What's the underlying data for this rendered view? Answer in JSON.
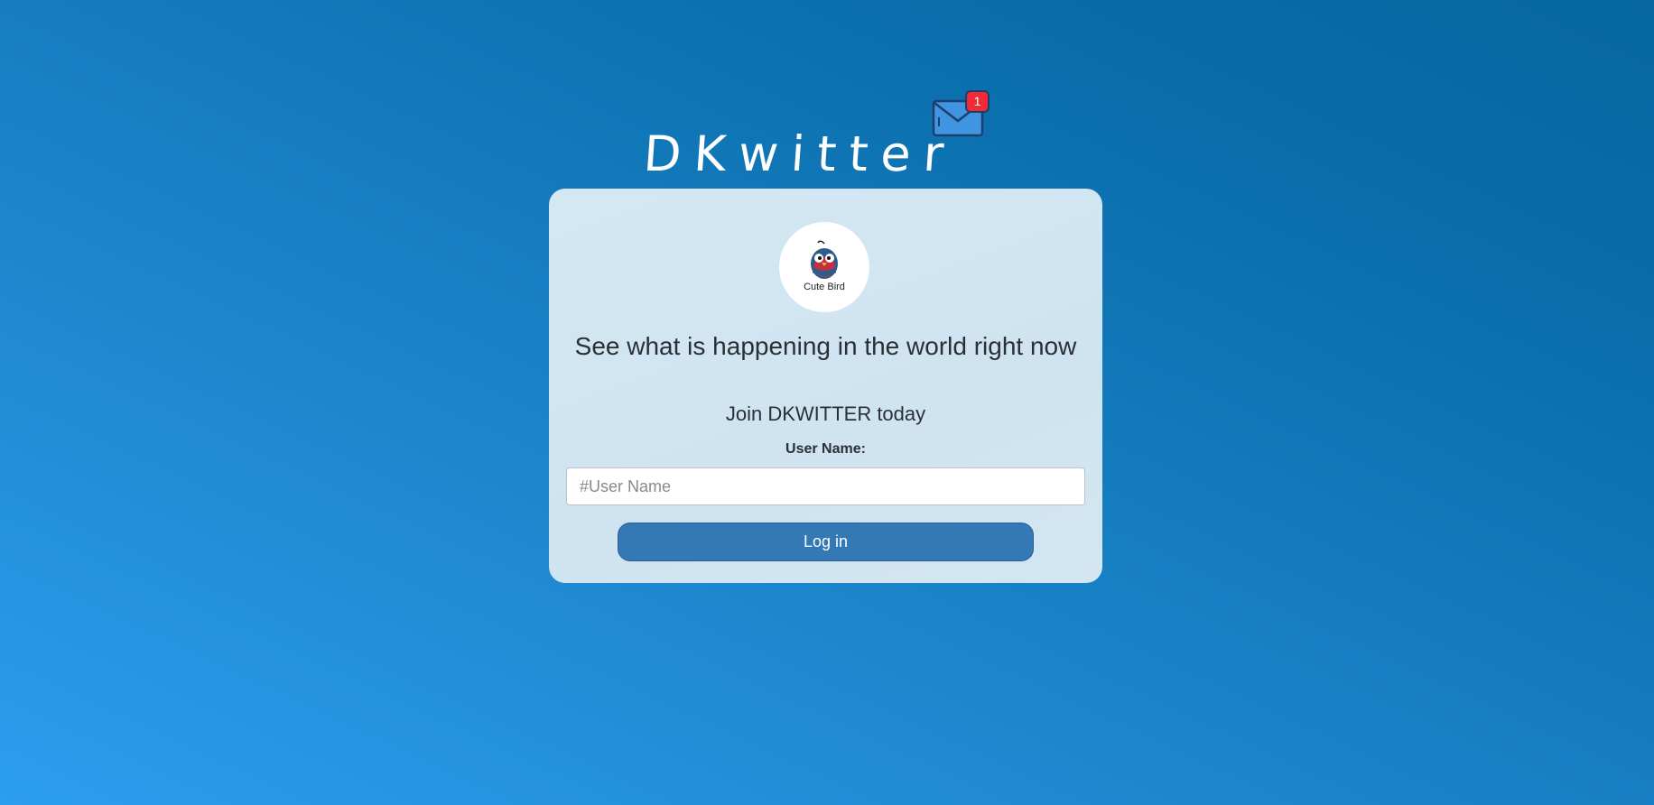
{
  "header": {
    "app_title": "DKwitter",
    "mail_icon": "envelope-notification-icon",
    "notification_count": "1"
  },
  "card": {
    "avatar_icon": "cute-bird-logo-icon",
    "avatar_caption": "Cute Bird",
    "headline": "See what is happening in the world right now",
    "subheadline": "Join DKWITTER today",
    "username_label": "User Name:",
    "username_placeholder": "#User Name",
    "username_value": "",
    "login_label": "Log in"
  },
  "colors": {
    "background_start": "#2d9df0",
    "background_end": "#06679f",
    "card_background": "#d4e8f4",
    "button_background": "#3578b6",
    "badge_background": "#ef2b36"
  }
}
